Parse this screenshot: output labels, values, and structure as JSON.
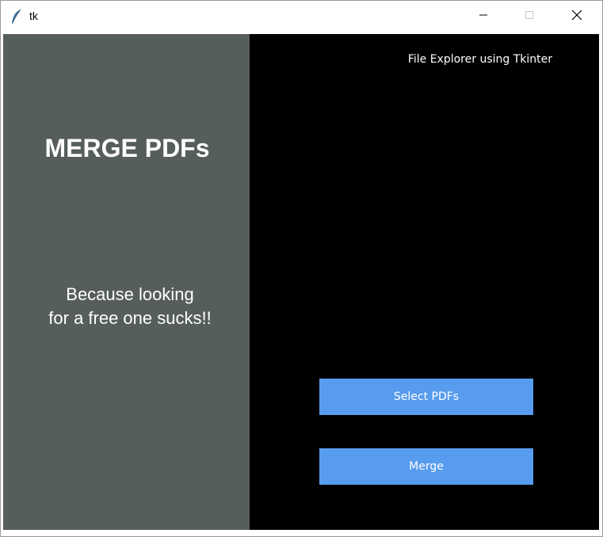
{
  "window": {
    "title": "tk",
    "controls": {
      "minimize": "minimize",
      "maximize": "maximize",
      "close": "close"
    },
    "icon": "feather-icon"
  },
  "left_panel": {
    "heading": "MERGE PDFs",
    "tagline": "Because looking\nfor a free one sucks!!",
    "background": "#565e5a"
  },
  "right_panel": {
    "label": "File Explorer using Tkinter",
    "select_button": "Select PDFs",
    "merge_button": "Merge",
    "background": "#000000",
    "button_color": "#589cef"
  }
}
